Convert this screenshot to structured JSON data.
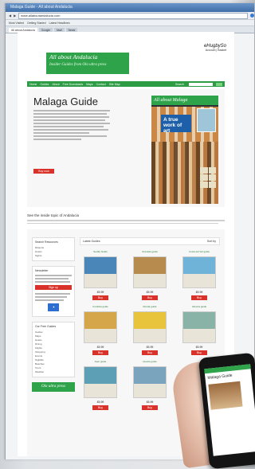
{
  "browser": {
    "title": "Malaga Guide - All about Andalucia",
    "address": "www.allaboutandalucia.com",
    "bookmarks": [
      "Most Visited",
      "Getting Started",
      "Latest Headlines"
    ],
    "tabs": [
      "All about Andalucia",
      "Google",
      "Mail",
      "News"
    ]
  },
  "site": {
    "logo_title": "All about Andalucia",
    "logo_tagline": "Insider Guides from Ola ultra press",
    "top_right_brand": "eHugbySo",
    "top_right_sub": "Account | Basket",
    "nav": [
      "Home",
      "Guides",
      "About",
      "Free Downloads",
      "Maps",
      "Contact",
      "Site Map"
    ],
    "nav_search_label": "Search",
    "go_label": "Go"
  },
  "hero": {
    "title": "Malaga Guide",
    "buy_label": "Buy now",
    "book_header": "All about Malaga",
    "book_callout": "A true work of art"
  },
  "section": {
    "heading": "See the inside topic of Andalucia"
  },
  "sidebar": {
    "box1_title": "Search Resources",
    "box1_items": [
      "Rstaurts",
      "Hotels",
      "Sights"
    ],
    "box2_title": "Newsletter",
    "box2_button": "Sign up",
    "box3_title": "Our Free Guides",
    "box3_items": [
      "Guides",
      "Maps",
      "Hotels",
      "Dining",
      "Flights",
      "Shopping",
      "Events",
      "Nightlife",
      "Beaches",
      "Tours",
      "Weather"
    ],
    "banner": "Ola ultra press"
  },
  "grid": {
    "heading": "Latest Guides",
    "sort_label": "Sort by",
    "cards": [
      {
        "title": "Seville Guide",
        "price": "£5.99",
        "color": "#4a86b8"
      },
      {
        "title": "Granada guide",
        "price": "£5.99",
        "color": "#b78a4e"
      },
      {
        "title": "Costa del Sol guide",
        "price": "£5.99",
        "color": "#6fb4d8"
      },
      {
        "title": "Cordoba guide",
        "price": "£5.99",
        "color": "#d6a64a"
      },
      {
        "title": "Ronda guide",
        "price": "£5.99",
        "color": "#e7c43c"
      },
      {
        "title": "Almeria guide",
        "price": "£5.99",
        "color": "#89b3a6"
      },
      {
        "title": "Jaen guide",
        "price": "£5.99",
        "color": "#5d9fb5"
      },
      {
        "title": "Huelva guide",
        "price": "£5.99",
        "color": "#7aa3bd"
      }
    ],
    "buy_label": "Buy"
  },
  "phone": {
    "title": "Malaga Guide"
  }
}
